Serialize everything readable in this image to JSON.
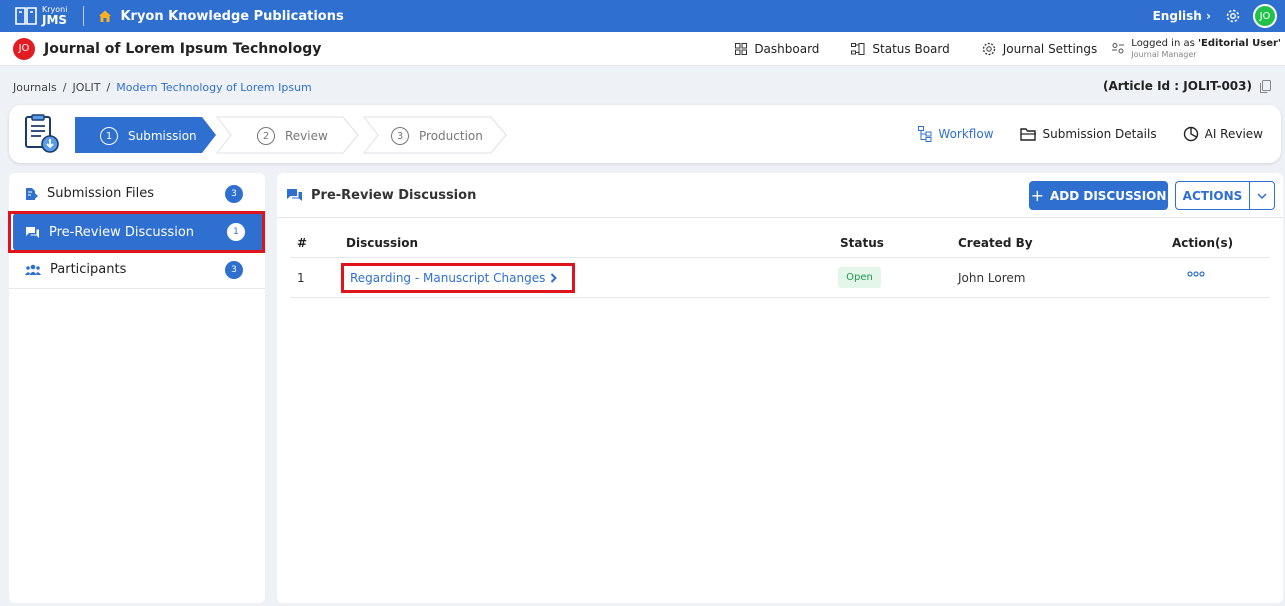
{
  "topbar": {
    "logo_small": "Kryoni",
    "logo_big": "JMS",
    "org_name": "Kryon Knowledge Publications",
    "language": "English",
    "avatar": "JO"
  },
  "journal": {
    "avatar": "JO",
    "title": "Journal of Lorem Ipsum Technology",
    "nav": [
      "Dashboard",
      "Status Board",
      "Journal Settings"
    ],
    "login_prefix": "Logged in as ",
    "login_user": "'Editorial User'",
    "login_role": "Journal Manager"
  },
  "breadcrumb": {
    "items": [
      "Journals",
      "JOLIT",
      "Modern Technology of Lorem Ipsum"
    ],
    "separator": "/",
    "article_id": "(Article Id : JOLIT-003)"
  },
  "stepper": {
    "steps": [
      {
        "num": "1",
        "label": "Submission"
      },
      {
        "num": "2",
        "label": "Review"
      },
      {
        "num": "3",
        "label": "Production"
      }
    ],
    "tabs": [
      "Workflow",
      "Submission Details",
      "AI Review"
    ]
  },
  "sidebar": {
    "items": [
      {
        "label": "Submission Files",
        "count": "3"
      },
      {
        "label": "Pre-Review Discussion",
        "count": "1"
      },
      {
        "label": "Participants",
        "count": "3"
      }
    ]
  },
  "main": {
    "title": "Pre-Review Discussion",
    "add_button": "ADD DISCUSSION",
    "add_plus": "+",
    "actions_button": "ACTIONS",
    "columns": [
      "#",
      "Discussion",
      "Status",
      "Created By",
      "Action(s)"
    ],
    "rows": [
      {
        "num": "1",
        "discussion": "Regarding - Manuscript Changes",
        "status": "Open",
        "created_by": "John Lorem"
      }
    ]
  },
  "colors": {
    "primary": "#2f6fd0",
    "highlight": "#e0141b",
    "status_open_bg": "#e4f5ea",
    "status_open_text": "#1c9a4e",
    "avatar_red": "#e11d23",
    "avatar_green": "#22c24a"
  },
  "icons": [
    "books-logo-icon",
    "home-icon",
    "chevron-right-icon",
    "gear-icon",
    "grid-icon",
    "board-icon",
    "settings-cog-icon",
    "user-swap-icon",
    "clipboard-doc-icon",
    "workflow-icon",
    "folder-icon",
    "pie-chart-icon",
    "file-icon",
    "chat-icon",
    "people-icon",
    "more-dots-icon",
    "chevron-down-icon",
    "copy-icon"
  ]
}
